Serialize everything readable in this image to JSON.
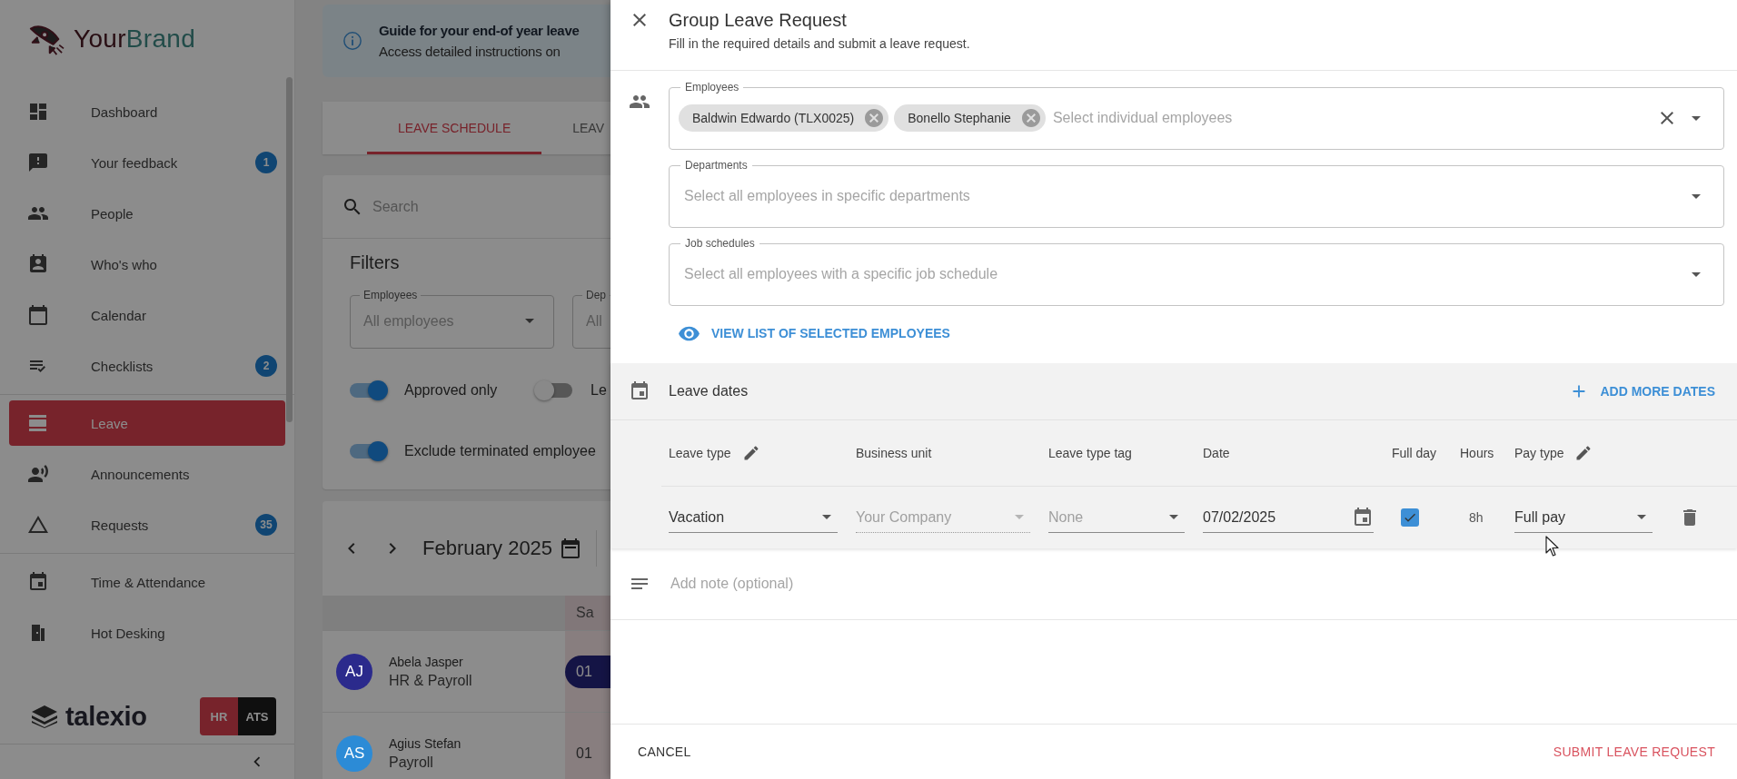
{
  "sidebar": {
    "brand": {
      "first": "Your",
      "second": "Brand"
    },
    "sections": [
      {
        "items": [
          {
            "label": "Dashboard",
            "selected": false
          },
          {
            "label": "Your feedback",
            "badge": "1",
            "selected": false
          },
          {
            "label": "People",
            "selected": false
          },
          {
            "label": "Who's who",
            "selected": false
          },
          {
            "label": "Calendar",
            "selected": false
          },
          {
            "label": "Checklists",
            "badge": "2",
            "selected": false
          }
        ]
      },
      {
        "items": [
          {
            "label": "Leave",
            "selected": true
          },
          {
            "label": "Announcements",
            "selected": false
          },
          {
            "label": "Requests",
            "badge": "35",
            "selected": false
          }
        ]
      },
      {
        "items": [
          {
            "label": "Time & Attendance",
            "selected": false
          },
          {
            "label": "Hot Desking",
            "selected": false
          }
        ]
      }
    ],
    "product": "talexio",
    "modules": [
      {
        "label": "HR",
        "selected": true
      },
      {
        "label": "ATS",
        "selected": false
      }
    ]
  },
  "main": {
    "banner": {
      "title": "Guide for your end-of year leave",
      "text": "Access detailed instructions on"
    },
    "tabs": [
      {
        "label": "LEAVE SCHEDULE",
        "selected": true
      },
      {
        "label": "LEAV",
        "selected": false
      }
    ],
    "search": {
      "placeholder": "Search"
    },
    "filters": {
      "title": "Filters",
      "fields": [
        {
          "label": "Employees",
          "placeholder": "All employees"
        },
        {
          "label": "Dep",
          "placeholder": "All"
        }
      ],
      "toggle_rows": [
        [
          {
            "label": "Approved only",
            "on": true
          },
          {
            "label": "Le",
            "on": false
          }
        ],
        [
          {
            "label": "Exclude terminated employee",
            "on": true
          }
        ]
      ]
    },
    "schedule": {
      "month": "February 2025",
      "day_header": "Sa",
      "rows": [
        {
          "initials": "AJ",
          "color": "#2b2a8c",
          "name": "Abela Jasper",
          "team": "HR & Payroll",
          "day": "01",
          "booked": true
        },
        {
          "initials": "AS",
          "color": "#2c8bd6",
          "name": "Agius Stefan",
          "team": "Payroll",
          "day": "01",
          "booked": false
        }
      ]
    }
  },
  "dialog": {
    "title": "Group Leave Request",
    "subtitle": "Fill in the required details and submit a leave request.",
    "employees": {
      "label": "Employees",
      "chips": [
        "Baldwin Edwardo (TLX0025)",
        "Bonello Stephanie"
      ],
      "placeholder": "Select individual employees"
    },
    "departments": {
      "label": "Departments",
      "placeholder": "Select all employees in specific departments"
    },
    "job_schedules": {
      "label": "Job schedules",
      "placeholder": "Select all employees with a specific job schedule"
    },
    "view_link": "VIEW LIST OF SELECTED EMPLOYEES",
    "leave_dates": {
      "title": "Leave dates",
      "add_button": "ADD MORE DATES",
      "columns": [
        {
          "label": "Leave type",
          "kind": "editable"
        },
        {
          "label": "Business unit",
          "kind": "plain"
        },
        {
          "label": "Leave type tag",
          "kind": "plain"
        },
        {
          "label": "Date",
          "kind": "plain"
        },
        {
          "label": "Full day",
          "kind": "plain"
        },
        {
          "label": "Hours",
          "kind": "plain"
        },
        {
          "label": "Pay type",
          "kind": "editable"
        }
      ],
      "rows": [
        {
          "cells": [
            {
              "kind": "select",
              "value": "Vacation",
              "disabled": false
            },
            {
              "kind": "select",
              "value": "Your Company",
              "disabled": true
            },
            {
              "kind": "select",
              "placeholder": "None",
              "disabled": false
            },
            {
              "kind": "date",
              "value": "07/02/2025"
            },
            {
              "kind": "checkbox",
              "checked": true
            },
            {
              "kind": "text",
              "value": "8h"
            },
            {
              "kind": "select",
              "value": "Full pay",
              "disabled": false
            }
          ]
        }
      ]
    },
    "note": {
      "placeholder": "Add note (optional)"
    },
    "actions": {
      "cancel": "CANCEL",
      "submit": "SUBMIT LEAVE REQUEST"
    }
  }
}
